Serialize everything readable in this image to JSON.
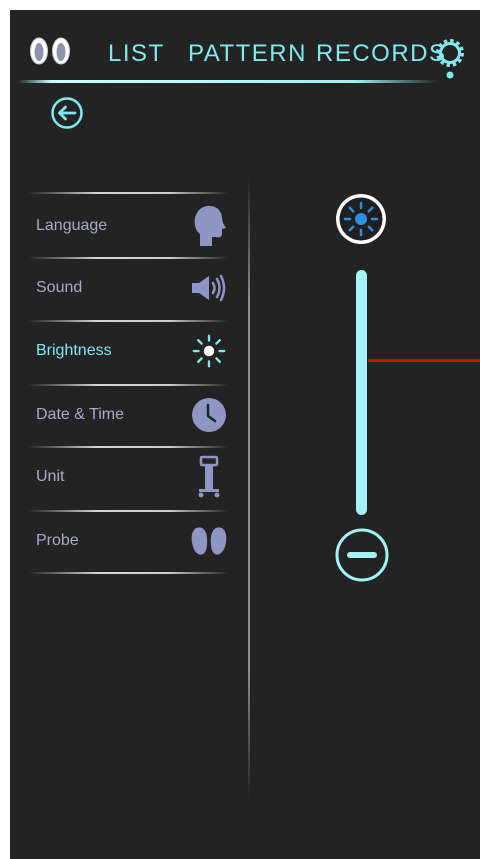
{
  "nav": {
    "tabs": [
      {
        "label": "LIST"
      },
      {
        "label": "PATTERN"
      },
      {
        "label": "RECORDS"
      }
    ]
  },
  "settings_menu": {
    "items": [
      {
        "label": "Language",
        "icon": "head-profile-icon"
      },
      {
        "label": "Sound",
        "icon": "speaker-icon"
      },
      {
        "label": "Brightness",
        "icon": "sun-icon",
        "active": true
      },
      {
        "label": "Date & Time",
        "icon": "clock-icon"
      },
      {
        "label": "Unit",
        "icon": "device-cart-icon"
      },
      {
        "label": "Probe",
        "icon": "probe-pads-icon"
      }
    ]
  },
  "brightness_slider": {
    "increase_icon": "sun-icon",
    "decrease_icon": "minus-circle-icon",
    "level": 1.0
  },
  "colors": {
    "background": "#232323",
    "accent": "#7fe9ef",
    "menu_text": "#a7abc7",
    "icon": "#8f96c3",
    "slider_track": "#a4f3f6",
    "annotation_line": "#e00000"
  }
}
